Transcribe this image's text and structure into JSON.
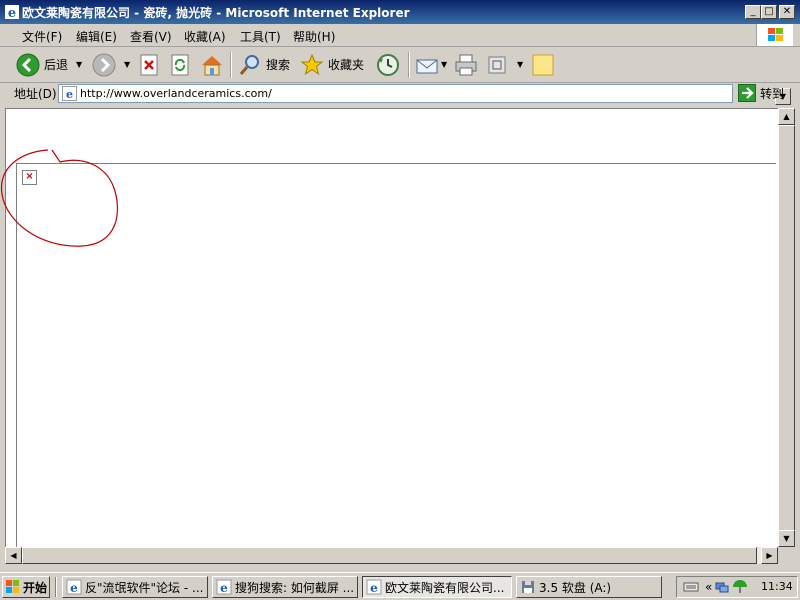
{
  "window": {
    "title": "欧文莱陶瓷有限公司 - 瓷砖, 抛光砖 - Microsoft Internet Explorer",
    "minimize": "_",
    "maximize": "□",
    "close": "✕"
  },
  "menu": {
    "items": [
      "文件(F)",
      "编辑(E)",
      "查看(V)",
      "收藏(A)",
      "工具(T)",
      "帮助(H)"
    ]
  },
  "toolbar": {
    "back_label": "后退",
    "search_label": "搜索",
    "favorites_label": "收藏夹"
  },
  "address": {
    "label": "地址(D)",
    "url": "http://www.overlandceramics.com/",
    "go_label": "转到"
  },
  "taskbar": {
    "start_label": "开始",
    "tasks": [
      "反\"流氓软件\"论坛 - ...",
      "搜狗搜索: 如何截屏 ...",
      "欧文莱陶瓷有限公司...",
      "3.5 软盘 (A:)"
    ],
    "tray_chevron": "«",
    "clock": "11:34"
  },
  "colors": {
    "titlebar": "#0a246a",
    "annotation_circle": "#c00000",
    "broken_image_x": "#e00000"
  }
}
